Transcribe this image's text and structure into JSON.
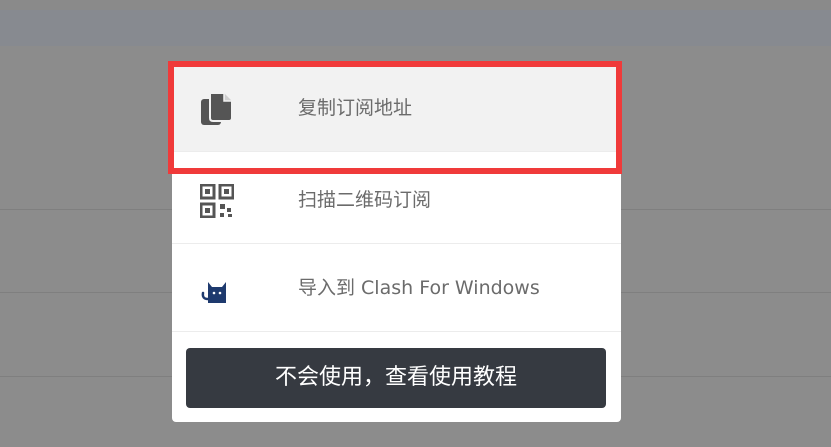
{
  "menu": {
    "items": [
      {
        "label": "复制订阅地址",
        "icon": "copy-icon"
      },
      {
        "label": "扫描二维码订阅",
        "icon": "qrcode-icon"
      },
      {
        "label": "导入到 Clash For Windows",
        "icon": "clash-cat-icon"
      }
    ],
    "help_button_label": "不会使用，查看使用教程"
  },
  "colors": {
    "overlay": "#8c8c8c",
    "highlight": "#f03a3a",
    "button_bg": "#363a41",
    "icon": "#555555",
    "cat": "#1e3a6e"
  }
}
